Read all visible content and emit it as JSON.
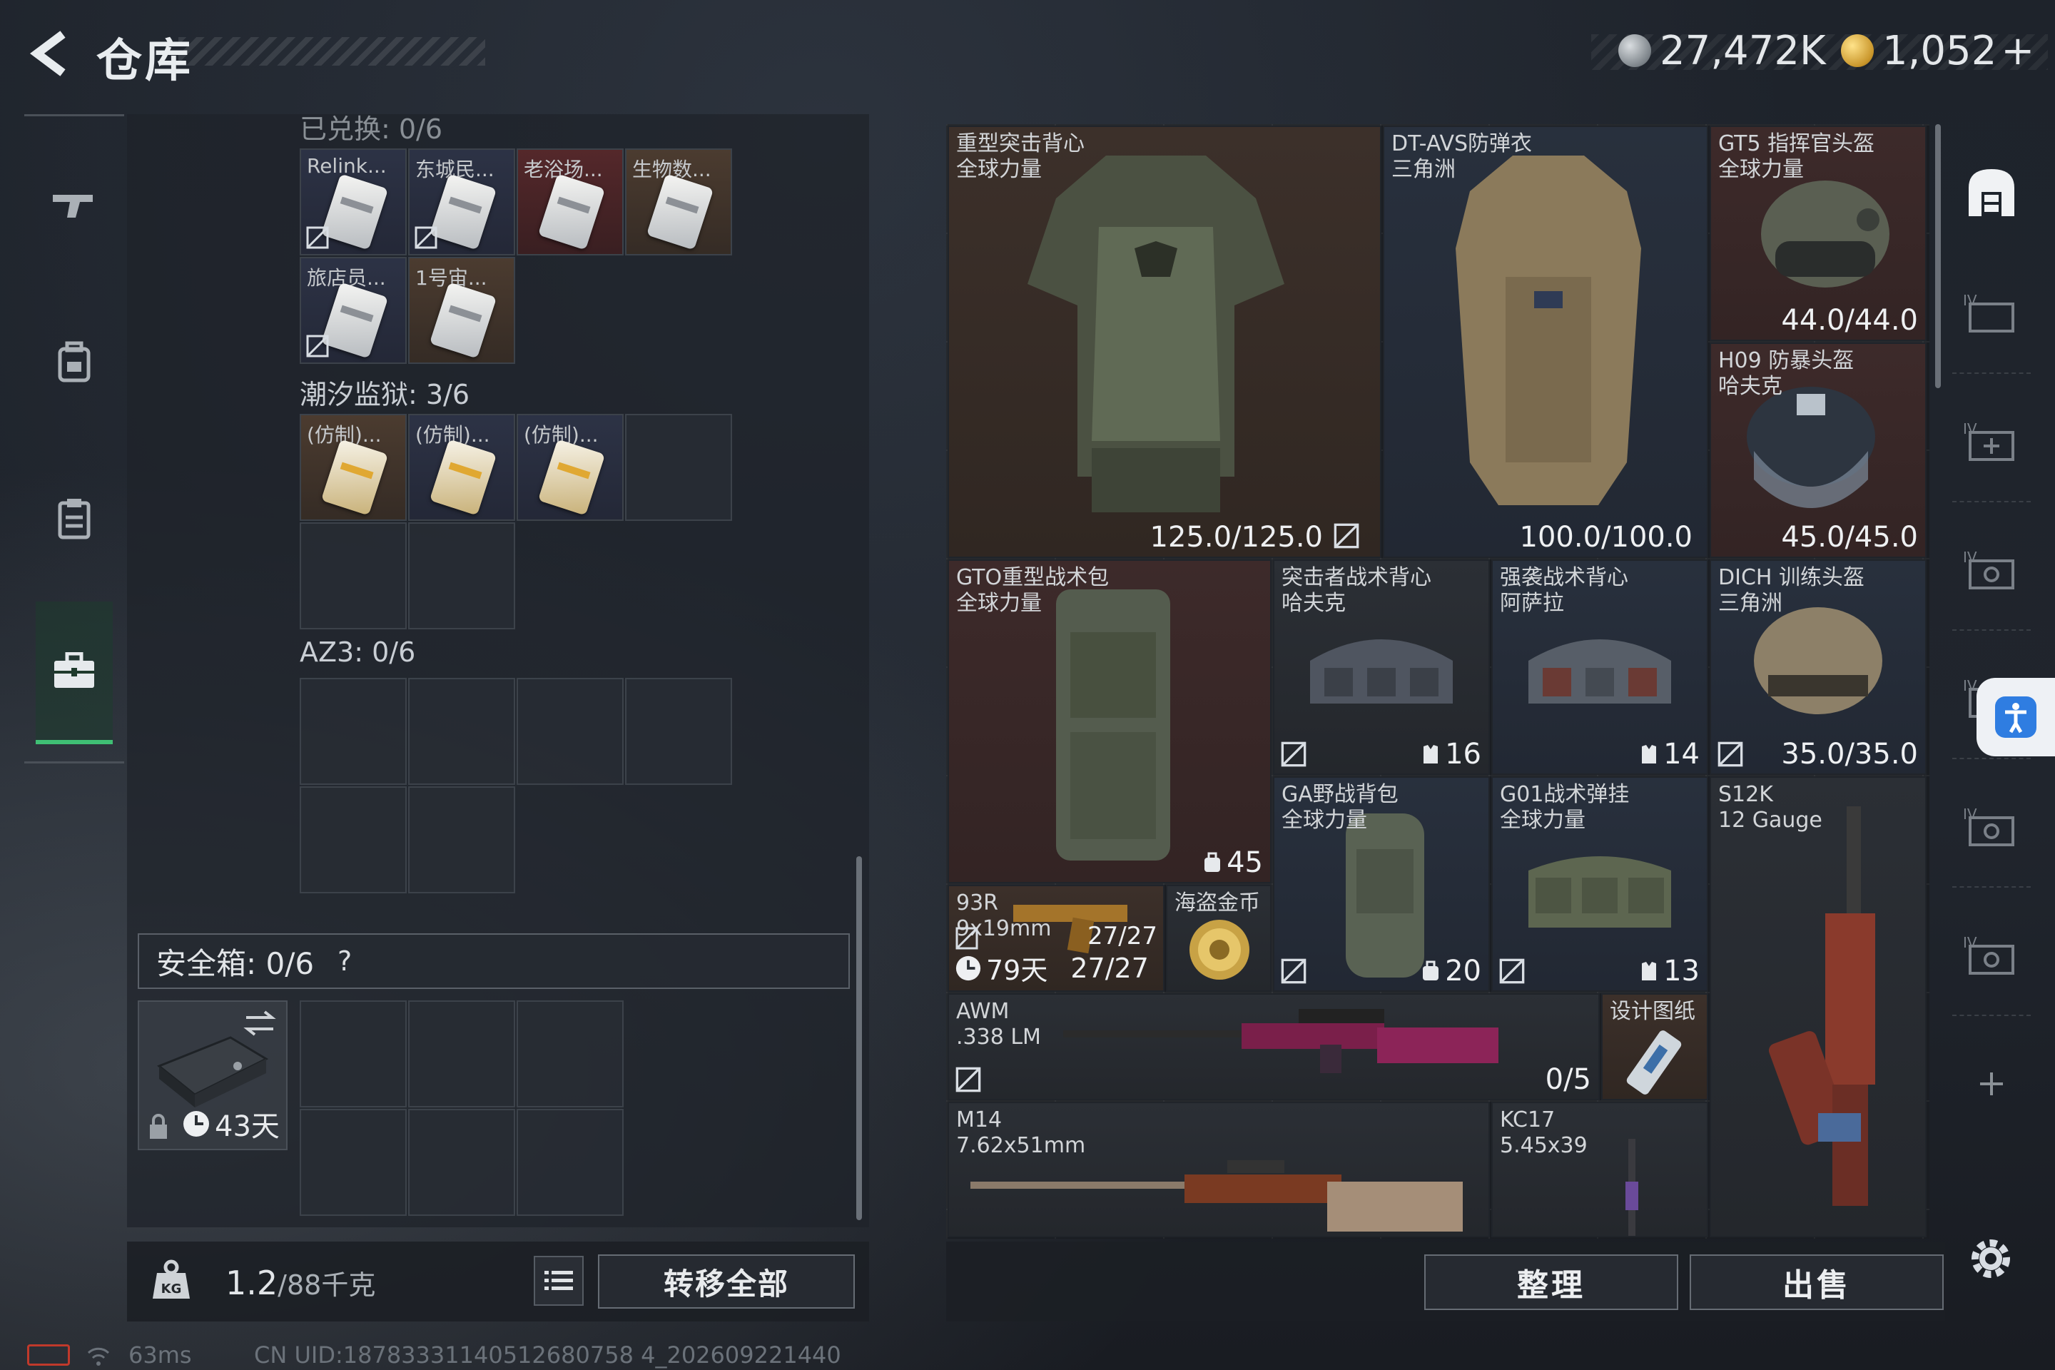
{
  "header": {
    "title": "仓库",
    "currency_silver": "27,472K",
    "currency_gold": "1,052",
    "currency_gold_plus": "+"
  },
  "left_panel": {
    "top_cut_label": "已兑换: 0/6",
    "section1_items": [
      {
        "label": "Relink..."
      },
      {
        "label": "东城民..."
      },
      {
        "label": "老浴场..."
      },
      {
        "label": "生物数..."
      },
      {
        "label": "旅店员..."
      },
      {
        "label": "1号宙..."
      }
    ],
    "section2_label": "潮汐监狱: 3/6",
    "section2_items": [
      {
        "label": "(仿制)..."
      },
      {
        "label": "(仿制)..."
      },
      {
        "label": "(仿制)..."
      }
    ],
    "section3_label": "AZ3: 0/6",
    "safebox_label": "安全箱: 0/6",
    "safebox_help": "?",
    "safe_case_days": "43天"
  },
  "bottom_left": {
    "weight_current": "1.2",
    "weight_max": "/88千克",
    "transfer_all": "转移全部"
  },
  "status": {
    "ping": "63ms",
    "uid": "CN UID:18783331140512680758 4_202609221440"
  },
  "stash": {
    "items": [
      {
        "name": "重型突击背心",
        "sub": "全球力量",
        "value": "125.0/125.0"
      },
      {
        "name": "DT-AVS防弹衣",
        "sub": "三角洲",
        "value": "100.0/100.0"
      },
      {
        "name": "GT5 指挥官头盔",
        "sub": "全球力量",
        "value": "44.0/44.0"
      },
      {
        "name": "H09 防暴头盔",
        "sub": "哈夫克",
        "value": "45.0/45.0"
      },
      {
        "name": "GTO重型战术包",
        "sub": "全球力量",
        "value": "45"
      },
      {
        "name": "突击者战术背心",
        "sub": "哈夫克",
        "value": "16"
      },
      {
        "name": "强袭战术背心",
        "sub": "阿萨拉",
        "value": "14"
      },
      {
        "name": "DICH 训练头盔",
        "sub": "三角洲",
        "value": "35.0/35.0"
      },
      {
        "name": "GA野战背包",
        "sub": "全球力量",
        "value": "20"
      },
      {
        "name": "G01战术弹挂",
        "sub": "全球力量",
        "value": "13"
      },
      {
        "name": "S12K",
        "sub": "12 Gauge",
        "value": ""
      },
      {
        "name": "93R",
        "sub": "9x19mm",
        "value": "27/27",
        "timer": "79天",
        "timer_value": "27/27"
      },
      {
        "name": "海盗金币",
        "sub": "",
        "value": ""
      },
      {
        "name": "AWM",
        "sub": ".338 LM",
        "value": "0/5"
      },
      {
        "name": "设计图纸",
        "sub": "",
        "value": ""
      },
      {
        "name": "M14",
        "sub": "7.62x51mm",
        "value": ""
      },
      {
        "name": "KC17",
        "sub": "5.45x39",
        "value": ""
      }
    ]
  },
  "bottom_right": {
    "sort": "整理",
    "sell": "出售"
  },
  "colors": {
    "accent_green": "#3fbf74",
    "rarity_red": "#3d2a2a",
    "rarity_blue": "#28303d"
  }
}
